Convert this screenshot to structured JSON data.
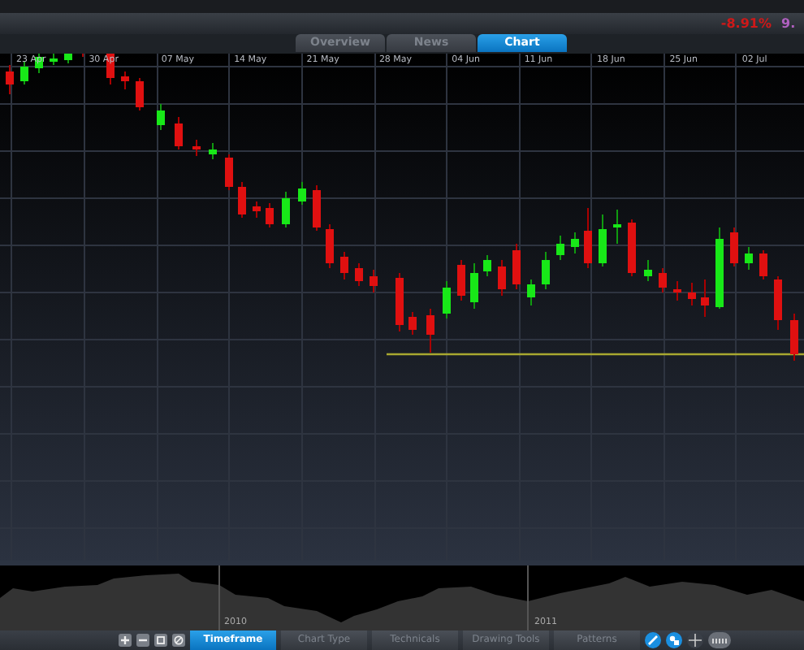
{
  "ticker": {
    "change": "-8.91%",
    "next_value": "9."
  },
  "view_tabs": [
    {
      "label": "Overview",
      "selected": false
    },
    {
      "label": "News",
      "selected": false
    },
    {
      "label": "Chart",
      "selected": true
    }
  ],
  "chart": {
    "date_labels": [
      "23 Apr",
      "30 Apr",
      "07 May",
      "14 May",
      "21 May",
      "28 May",
      "04 Jun",
      "11 Jun",
      "18 Jun",
      "25 Jun",
      "02 Jul"
    ]
  },
  "navigator": {
    "year_labels": [
      "2010",
      "2011"
    ]
  },
  "tool_tabs": [
    {
      "label": "Timeframe",
      "selected": true
    },
    {
      "label": "Chart Type",
      "selected": false
    },
    {
      "label": "Technicals",
      "selected": false
    },
    {
      "label": "Drawing Tools",
      "selected": false
    },
    {
      "label": "Patterns",
      "selected": false
    }
  ]
}
